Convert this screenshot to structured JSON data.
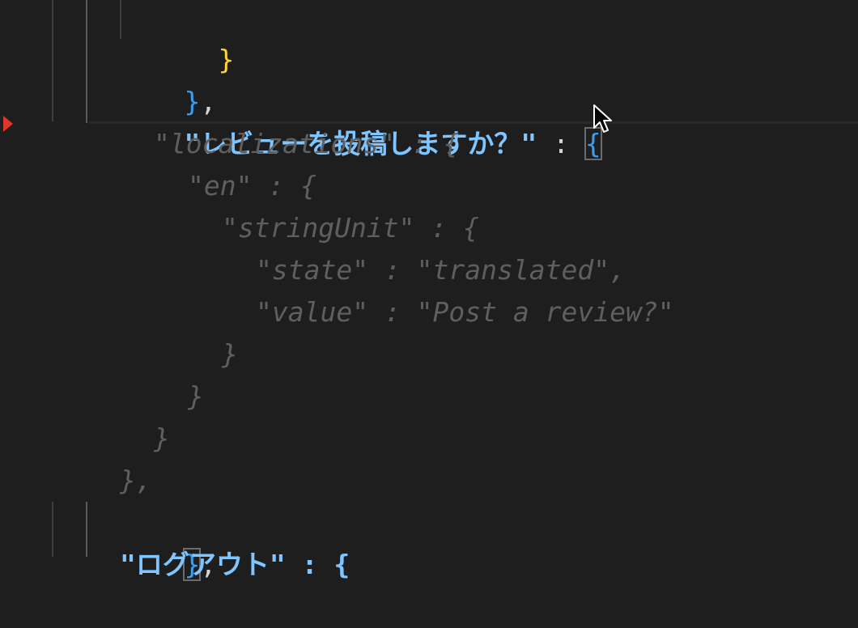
{
  "editor": {
    "lines": {
      "l1": {
        "brace": "}"
      },
      "l2": {
        "brace": "}",
        "comma": ","
      },
      "l3": {
        "key": "\"レビューを投稿しますか？\"",
        "colon": " : ",
        "brace": "{"
      },
      "l4": {
        "text": "\"localizations\" : {"
      },
      "l5": {
        "text": "\"en\" : {"
      },
      "l6": {
        "text": "\"stringUnit\" : {"
      },
      "l7": {
        "text": "\"state\" : \"translated\","
      },
      "l8": {
        "text": "\"value\" : \"Post a review?\""
      },
      "l9": {
        "text": "}"
      },
      "l10": {
        "text": "}"
      },
      "l11": {
        "text": "}"
      },
      "l12": {
        "text": "},"
      },
      "l13": {
        "brace": "}",
        "comma": ","
      },
      "l14": {
        "text": "\"ログアウト\" : {"
      }
    }
  },
  "colors": {
    "background": "#1e1e1e",
    "key": "#7fc5ff",
    "brace_blue": "#3b9ff0",
    "brace_yellow": "#ffd43b",
    "folded_text": "#5f5f5f",
    "breakpoint_marker": "#e0352b"
  },
  "icons": {
    "mouse_pointer": "mouse-pointer-icon",
    "breakpoint": "breakpoint-marker-icon"
  }
}
